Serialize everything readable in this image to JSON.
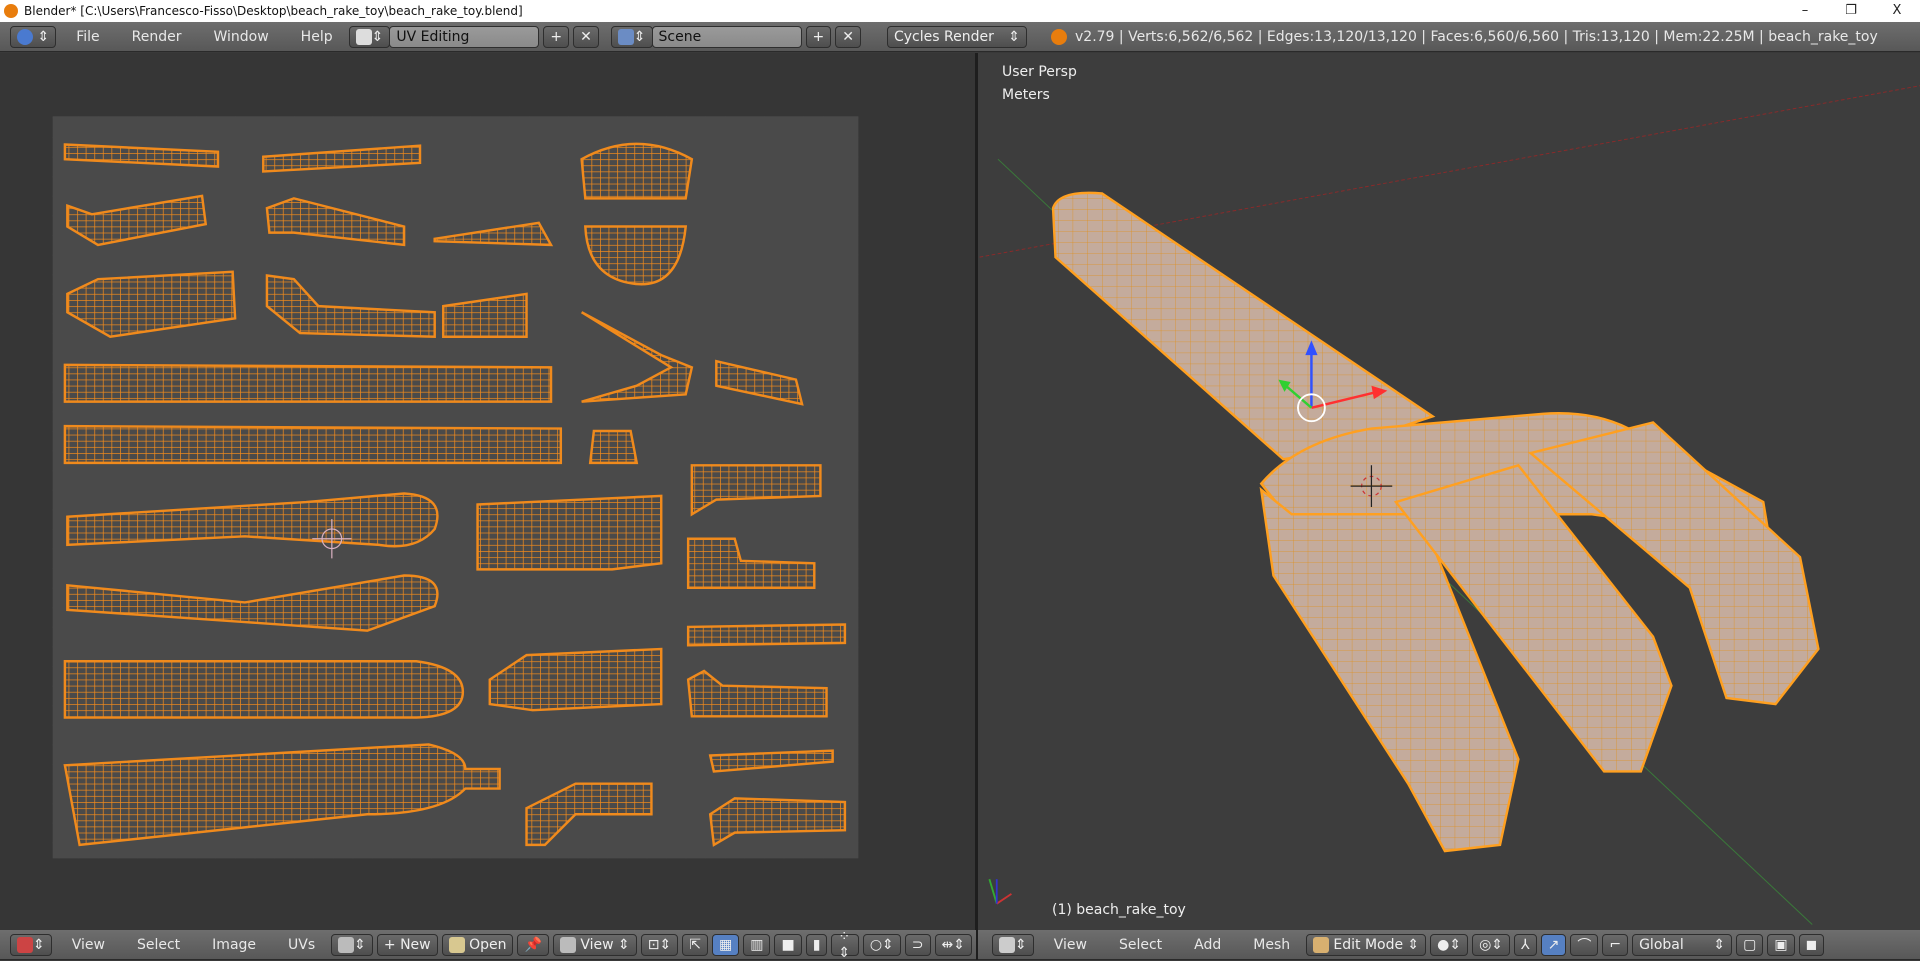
{
  "window": {
    "title": "Blender* [C:\\Users\\Francesco-Fisso\\Desktop\\beach_rake_toy\\beach_rake_toy.blend]",
    "controls": [
      "–",
      "❐",
      "X"
    ]
  },
  "topbar": {
    "menus": [
      "File",
      "Render",
      "Window",
      "Help"
    ],
    "screen_layout": "UV Editing",
    "scene": "Scene",
    "render_engine": "Cycles Render",
    "stats": "v2.79 | Verts:6,562/6,562 | Edges:13,120/13,120 | Faces:6,560/6,560 | Tris:13,120 | Mem:22.25M | beach_rake_toy"
  },
  "uv_editor": {
    "menus": [
      "View",
      "Select",
      "Image",
      "UVs"
    ],
    "new_label": "New",
    "open_label": "Open",
    "view_label": "View"
  },
  "viewport": {
    "view_name": "User Persp",
    "units": "Meters",
    "object_label": "(1) beach_rake_toy",
    "menus": [
      "View",
      "Select",
      "Add",
      "Mesh"
    ],
    "mode": "Edit Mode",
    "orientation": "Global"
  },
  "colors": {
    "accent": "#f08a1c",
    "background": "#393939",
    "header": "#626262",
    "mesh_fill": "#c4ab9c"
  }
}
